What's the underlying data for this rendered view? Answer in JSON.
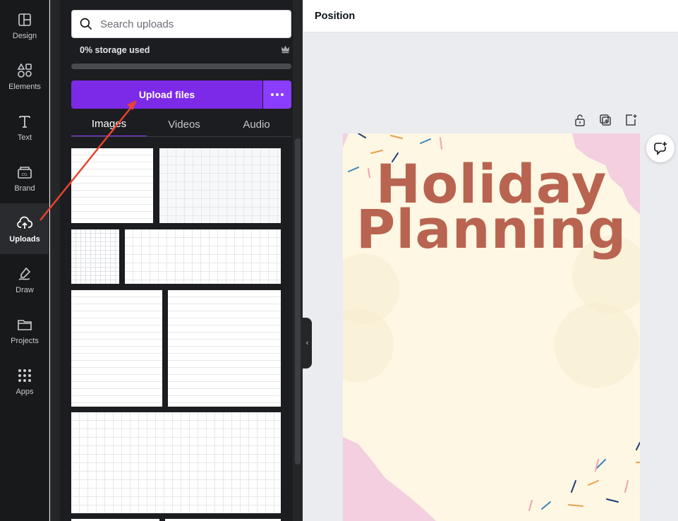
{
  "sidebar": {
    "items": [
      {
        "label": "Design",
        "icon": "layout-icon"
      },
      {
        "label": "Elements",
        "icon": "shapes-icon"
      },
      {
        "label": "Text",
        "icon": "text-icon"
      },
      {
        "label": "Brand",
        "icon": "brand-icon"
      },
      {
        "label": "Uploads",
        "icon": "cloud-upload-icon",
        "active": true
      },
      {
        "label": "Draw",
        "icon": "draw-icon"
      },
      {
        "label": "Projects",
        "icon": "folder-icon"
      },
      {
        "label": "Apps",
        "icon": "apps-grid-icon"
      }
    ]
  },
  "uploads": {
    "search_placeholder": "Search uploads",
    "storage_text": "0% storage used",
    "storage_fraction": 0,
    "upload_label": "Upload files",
    "tabs": [
      {
        "label": "Images",
        "active": true
      },
      {
        "label": "Videos"
      },
      {
        "label": "Audio"
      }
    ]
  },
  "topbar": {
    "title": "Position"
  },
  "design": {
    "title_line1": "Holiday",
    "title_line2": "Planning"
  },
  "colors": {
    "accent": "#8b3dff",
    "upload_button": "#7d2ae8",
    "rail_bg": "#18191b",
    "page_bg": "#fdf7e3",
    "title_color": "#b86450",
    "arrow": "#e8432e"
  }
}
